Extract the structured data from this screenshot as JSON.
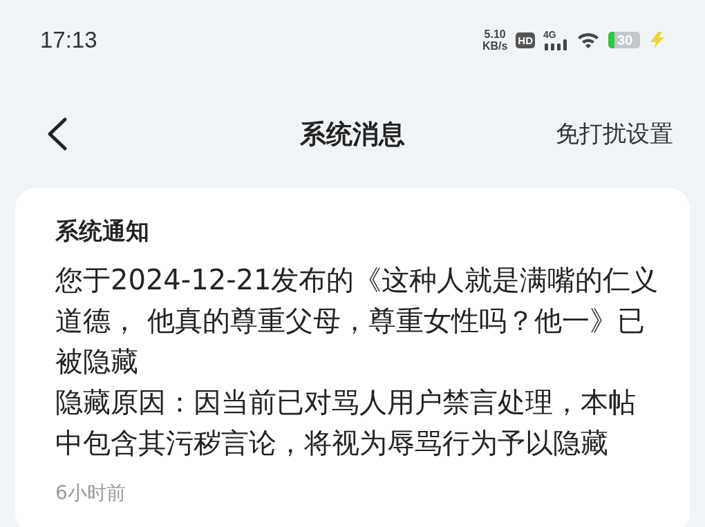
{
  "status_bar": {
    "time": "17:13",
    "net_speed": "5.10",
    "net_unit": "KB/s",
    "hd_badge": "HD",
    "network": "4G",
    "battery": "30",
    "charging": true
  },
  "header": {
    "title": "系统消息",
    "action": "免打扰设置"
  },
  "notices": [
    {
      "title": "系统通知",
      "lines": [
        "您于2024-12-21发布的《这种人就是满嘴的仁义",
        "道德， 他真的尊重父母，尊重女性吗？他一》已",
        "被隐藏",
        "隐藏原因：因当前已对骂人用户禁言处理，本帖",
        "中包含其污秽言论，将视为辱骂行为予以隐藏"
      ],
      "time": "6小时前"
    }
  ]
}
